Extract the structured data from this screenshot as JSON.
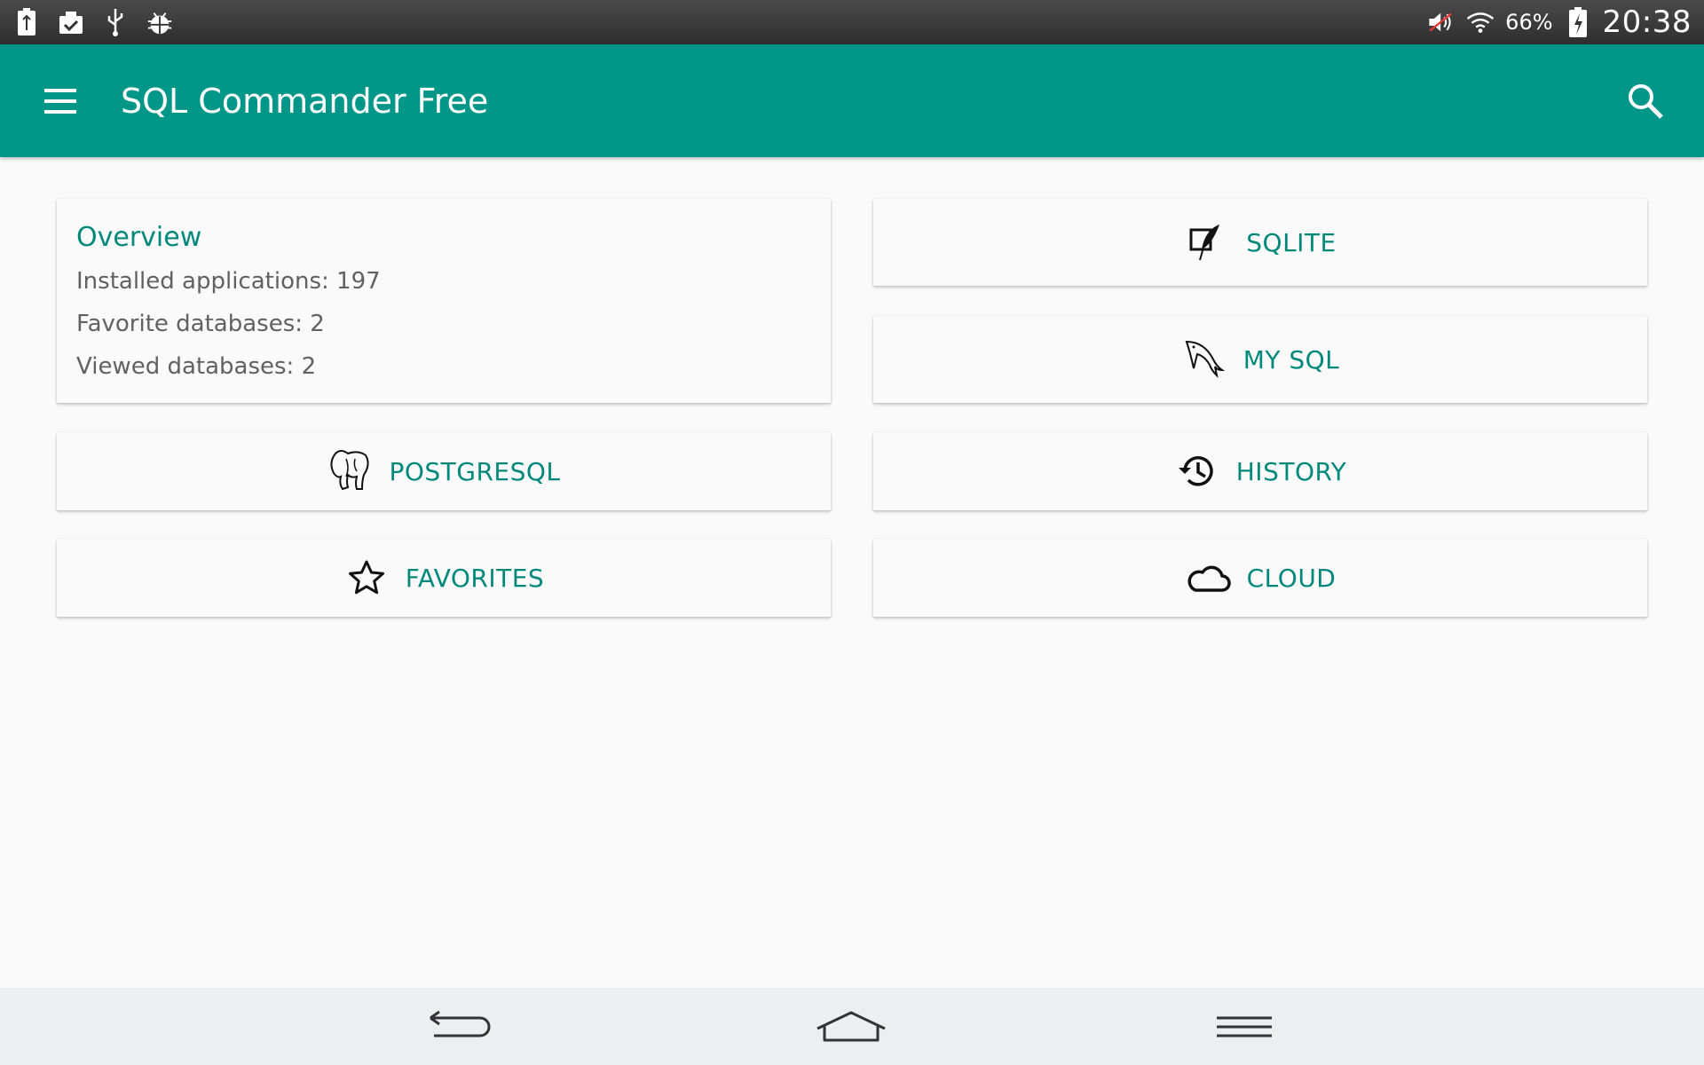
{
  "status_bar": {
    "battery_percent": "66%",
    "time": "20:38",
    "left_icons": [
      "battery-saver-icon",
      "clipboard-check-icon",
      "usb-icon",
      "android-debug-icon"
    ],
    "right_icons": [
      "volume-muted-icon",
      "wifi-icon",
      "battery-charging-icon"
    ]
  },
  "app_bar": {
    "title": "SQL Commander Free",
    "color": "#009688"
  },
  "overview": {
    "title": "Overview",
    "installed_applications": "Installed applications: 197",
    "favorite_databases": "Favorite databases: 2",
    "viewed_databases": "Viewed databases: 2"
  },
  "buttons": {
    "sqlite": {
      "label": "SQLITE",
      "icon": "feather-icon"
    },
    "mysql": {
      "label": "MY SQL",
      "icon": "dolphin-icon"
    },
    "postgresql": {
      "label": "POSTGRESQL",
      "icon": "elephant-icon"
    },
    "history": {
      "label": "HISTORY",
      "icon": "history-icon"
    },
    "favorites": {
      "label": "FAVORITES",
      "icon": "star-icon"
    },
    "cloud": {
      "label": "CLOUD",
      "icon": "cloud-icon"
    }
  },
  "nav_bar": {
    "buttons": [
      "back-icon",
      "home-icon",
      "menu-icon"
    ]
  },
  "accent_color": "#00897b"
}
